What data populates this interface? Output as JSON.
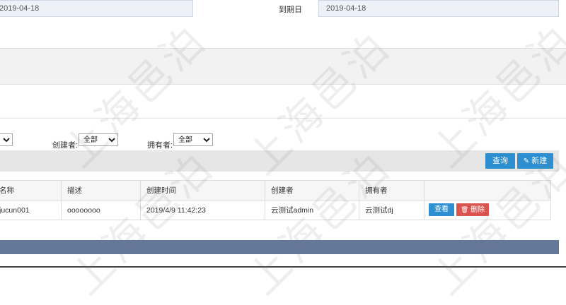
{
  "form": {
    "start_value": "2019-04-18",
    "due_label": "到期日",
    "due_value": "2019-04-18"
  },
  "filters": {
    "first_select_value": "",
    "creator_label": "创建者:",
    "creator_value": "全部",
    "owner_label": "拥有者:",
    "owner_value": "全部"
  },
  "toolbar": {
    "query_label": "查询",
    "new_label": "新建"
  },
  "table": {
    "headers": [
      "名称",
      "描述",
      "创建时间",
      "创建者",
      "拥有者",
      ""
    ],
    "rows": [
      {
        "name": "jucun001",
        "desc": "oooooooo",
        "created": "2019/4/9 11:42:23",
        "creator": "云测试admin",
        "owner": "云测试dj",
        "view_label": "查看",
        "delete_label": "删除"
      }
    ]
  },
  "watermark": "上海邑泊",
  "colors": {
    "accent_blue": "#2d8fd0",
    "danger_red": "#d9534f",
    "footer_bar": "#64789a"
  }
}
